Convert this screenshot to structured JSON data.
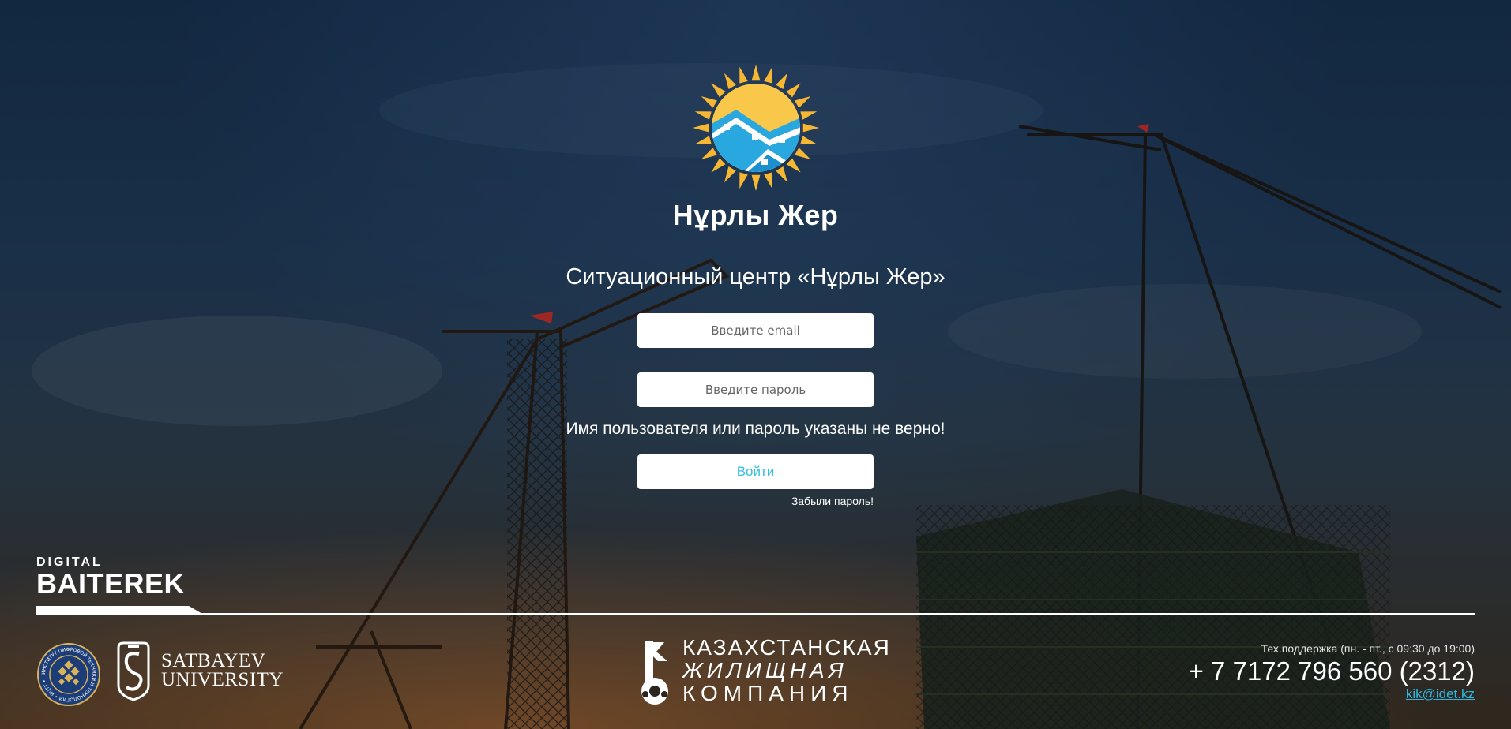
{
  "brand": {
    "name": "Нұрлы Жер",
    "title": "Ситуационный центр «Нұрлы Жер»"
  },
  "form": {
    "email_placeholder": "Введите email",
    "password_placeholder": "Введите пароль",
    "error_message": "Имя пользователя или пароль указаны не верно!",
    "login_label": "Войти",
    "forgot_label": "Забыли пароль!"
  },
  "footer": {
    "digital_baiterek": {
      "small": "DIGITAL",
      "big": "BAITEREK"
    },
    "seal_text": "ИНСТИТУТ ЦИФРОВОЙ ТЕХНИКИ И ТЕХНОЛОГИИ • ИЦТТ •",
    "satbayev": {
      "line1": "SATBAYEV",
      "line2": "UNIVERSITY"
    },
    "kzk": {
      "line1": "КАЗАХСТАНСКАЯ",
      "line2": "ЖИЛИЩНАЯ",
      "line3": "КОМПАНИЯ"
    },
    "support": {
      "hours": "Тех.поддержка (пн. - пт., с 09:30 до 19:00)",
      "phone": "+ 7 7172 796 560 (2312)",
      "email": "kik@idet.kz"
    }
  },
  "colors": {
    "accent": "#33c0dc",
    "sun": "#f7b733",
    "sky_blue": "#29a8e0",
    "link": "#2fb7e0"
  },
  "icons": {
    "logo": "sun-houses-logo",
    "seal": "institute-seal-icon",
    "satbayev": "satbayev-emblem-icon",
    "kzk": "key-logo-icon"
  }
}
